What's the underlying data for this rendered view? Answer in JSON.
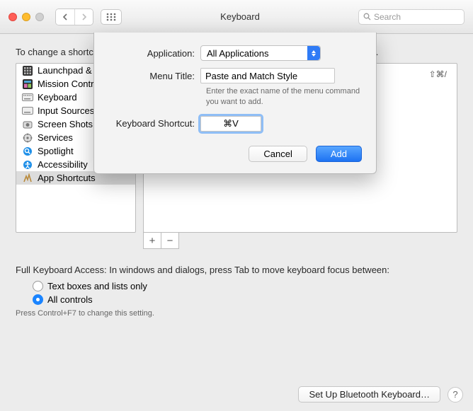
{
  "window": {
    "title": "Keyboard",
    "search_placeholder": "Search"
  },
  "description": "To change a shortcut, select it, double-click the key combination, and enter the new keys.",
  "sidebar": {
    "items": [
      {
        "label": "Launchpad & Dock",
        "icon": "launchpad-icon"
      },
      {
        "label": "Mission Control",
        "icon": "mission-control-icon"
      },
      {
        "label": "Keyboard",
        "icon": "keyboard-icon"
      },
      {
        "label": "Input Sources",
        "icon": "input-sources-icon"
      },
      {
        "label": "Screen Shots",
        "icon": "screenshots-icon"
      },
      {
        "label": "Services",
        "icon": "services-icon"
      },
      {
        "label": "Spotlight",
        "icon": "spotlight-icon"
      },
      {
        "label": "Accessibility",
        "icon": "accessibility-icon"
      },
      {
        "label": "App Shortcuts",
        "icon": "app-shortcuts-icon"
      }
    ],
    "selected_index": 8
  },
  "detail": {
    "sample_shortcut": "⇧⌘/"
  },
  "full_keyboard_access": {
    "text": "Full Keyboard Access: In windows and dialogs, press Tab to move keyboard focus between:",
    "options": [
      "Text boxes and lists only",
      "All controls"
    ],
    "selected_index": 1,
    "hint": "Press Control+F7 to change this setting."
  },
  "footer": {
    "bluetooth_button": "Set Up Bluetooth Keyboard…"
  },
  "sheet": {
    "labels": {
      "application": "Application:",
      "menu_title": "Menu Title:",
      "shortcut": "Keyboard Shortcut:"
    },
    "application_value": "All Applications",
    "menu_title_value": "Paste and Match Style",
    "menu_title_hint": "Enter the exact name of the menu command you want to add.",
    "shortcut_value": "⌘V",
    "cancel": "Cancel",
    "add": "Add"
  }
}
